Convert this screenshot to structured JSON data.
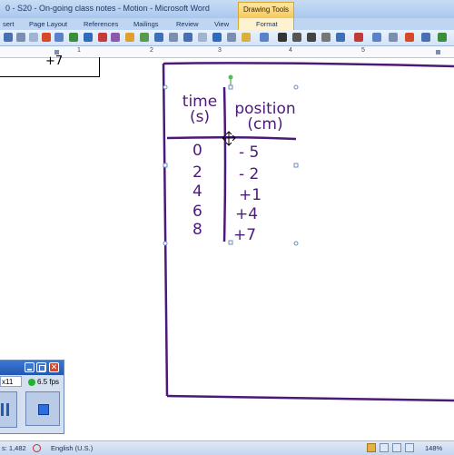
{
  "window": {
    "title": "0 - S20 - On-going class notes - Motion - Microsoft Word"
  },
  "contextual_tab": {
    "label": "Drawing Tools"
  },
  "tabs": [
    "sert",
    "Page Layout",
    "References",
    "Mailings",
    "Review",
    "View",
    "Format"
  ],
  "ruler": {
    "numbers": [
      "1",
      "2",
      "3",
      "4",
      "5"
    ]
  },
  "status": {
    "words": "s: 1,482",
    "language": "English (U.S.)",
    "zoom": "148%"
  },
  "recorder": {
    "counter": "x11",
    "fps": "6.5 fps"
  },
  "table_fragment": {
    "text": "+7"
  },
  "handwritten_table": {
    "headers": [
      [
        "time",
        "(s)"
      ],
      [
        "position",
        "(cm)"
      ]
    ],
    "rows": [
      [
        "0",
        "- 5"
      ],
      [
        "2",
        "- 2"
      ],
      [
        "4",
        "+1"
      ],
      [
        "6",
        "+4"
      ],
      [
        "8",
        "+7"
      ]
    ]
  },
  "icons": [
    "word-toolbar-icons",
    "green-rotate-handle",
    "selection-handles",
    "move-cursor-icon",
    "record-circle-icon",
    "pause-icon",
    "stop-icon",
    "minimize-icon",
    "restore-icon",
    "close-icon",
    "spellcheck-icon"
  ]
}
